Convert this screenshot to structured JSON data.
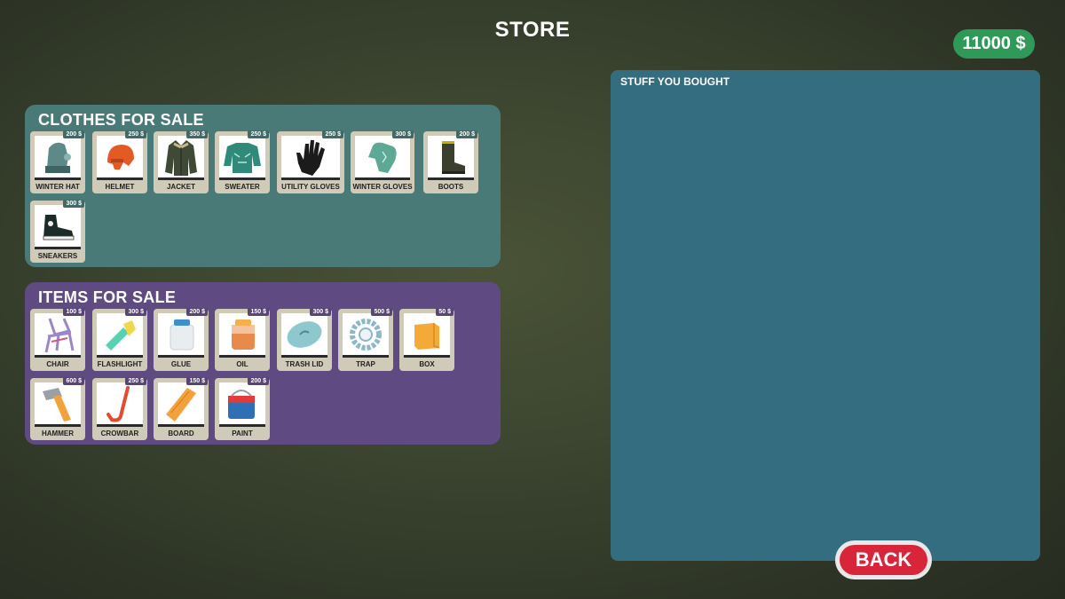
{
  "header": {
    "title": "STORE",
    "money": "11000 $"
  },
  "clothes": {
    "title": "CLOTHES FOR SALE",
    "items": [
      {
        "label": "WINTER HAT",
        "price": "200 $",
        "icon": "winter-hat-icon"
      },
      {
        "label": "HELMET",
        "price": "250 $",
        "icon": "helmet-icon"
      },
      {
        "label": "JACKET",
        "price": "350 $",
        "icon": "jacket-icon"
      },
      {
        "label": "SWEATER",
        "price": "250 $",
        "icon": "sweater-icon"
      },
      {
        "label": "UTILITY GLOVES",
        "price": "250 $",
        "icon": "utility-gloves-icon"
      },
      {
        "label": "WINTER GLOVES",
        "price": "300 $",
        "icon": "winter-gloves-icon"
      },
      {
        "label": "BOOTS",
        "price": "200 $",
        "icon": "boots-icon"
      },
      {
        "label": "SNEAKERS",
        "price": "300 $",
        "icon": "sneakers-icon"
      }
    ]
  },
  "items": {
    "title": "ITEMS FOR SALE",
    "items": [
      {
        "label": "CHAIR",
        "price": "100 $",
        "icon": "chair-icon"
      },
      {
        "label": "FLASHLIGHT",
        "price": "300 $",
        "icon": "flashlight-icon"
      },
      {
        "label": "GLUE",
        "price": "200 $",
        "icon": "glue-icon"
      },
      {
        "label": "OIL",
        "price": "150 $",
        "icon": "oil-icon"
      },
      {
        "label": "TRASH LID",
        "price": "300 $",
        "icon": "trash-lid-icon"
      },
      {
        "label": "TRAP",
        "price": "500 $",
        "icon": "trap-icon"
      },
      {
        "label": "BOX",
        "price": "50 $",
        "icon": "box-icon"
      },
      {
        "label": "HAMMER",
        "price": "600 $",
        "icon": "hammer-icon"
      },
      {
        "label": "CROWBAR",
        "price": "250 $",
        "icon": "crowbar-icon"
      },
      {
        "label": "BOARD",
        "price": "150 $",
        "icon": "board-icon"
      },
      {
        "label": "PAINT",
        "price": "200 $",
        "icon": "paint-icon"
      }
    ]
  },
  "bought": {
    "title": "STUFF YOU BOUGHT"
  },
  "footer": {
    "back_label": "BACK"
  },
  "colors": {
    "clothes_panel": "#4a7a78",
    "items_panel": "#5f4b82",
    "bought_panel": "#336d7f",
    "money_badge": "#2f9a57",
    "back_button": "#d9253a"
  }
}
